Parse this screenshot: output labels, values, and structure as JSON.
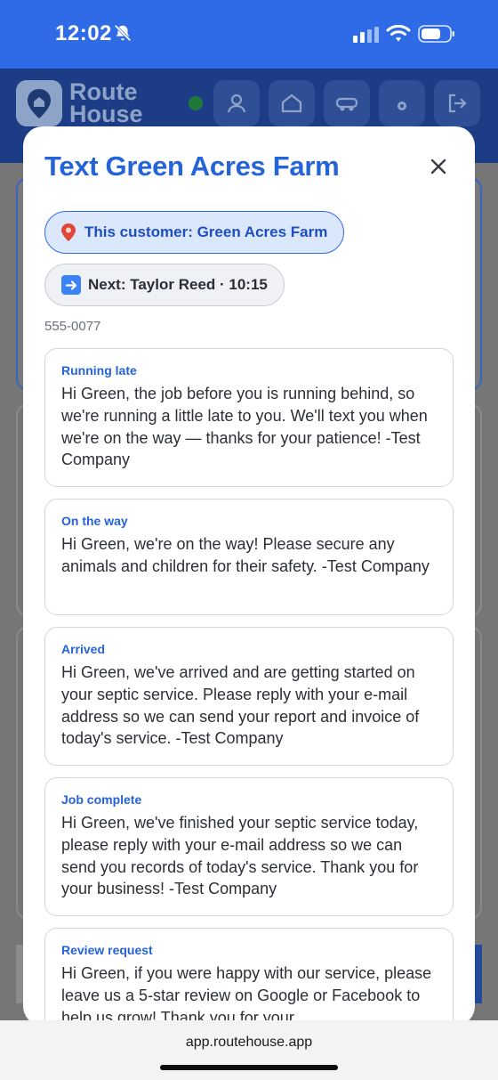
{
  "status_bar": {
    "time": "12:02",
    "icons": [
      "bell-slash-icon",
      "signal-icon",
      "wifi-icon",
      "battery-icon"
    ]
  },
  "app_header": {
    "logo_line1": "Route",
    "logo_line2": "House",
    "online_status_color": "#1f7a3a",
    "nav_icons": [
      "profile-icon",
      "home-icon",
      "truck-icon",
      "gear-icon",
      "logout-icon"
    ]
  },
  "modal": {
    "title": "Text Green Acres Farm",
    "customer_chip": "This customer: Green Acres Farm",
    "next_chip": "Next: Taylor Reed · 10:15",
    "phone": "555-0077",
    "templates": [
      {
        "label": "Running late",
        "text": "Hi Green, the job before you is running behind, so we're running a little late to you. We'll text you when we're on the way — thanks for your patience! -Test Company"
      },
      {
        "label": "On the way",
        "text": "Hi Green, we're on the way! Please secure any animals and children for their safety. -Test Company"
      },
      {
        "label": "Arrived",
        "text": "Hi Green, we've arrived and are getting started on your septic service. Please reply with your e-mail address so we can send your report and invoice of today's service. -Test Company"
      },
      {
        "label": "Job complete",
        "text": "Hi Green, we've finished your septic service today, please reply with your e-mail address so we can send you records of today's service. Thank you for your business! -Test Company"
      },
      {
        "label": "Review request",
        "text": "Hi Green, if you were happy with our service, please leave us a 5-star review on Google or Facebook to help us grow! Thank you for your"
      }
    ]
  },
  "browser": {
    "url": "app.routehouse.app"
  },
  "colors": {
    "accent": "#2563d8",
    "status_bar": "#2f6be6",
    "chip_customer_bg": "#dbe8fc"
  }
}
